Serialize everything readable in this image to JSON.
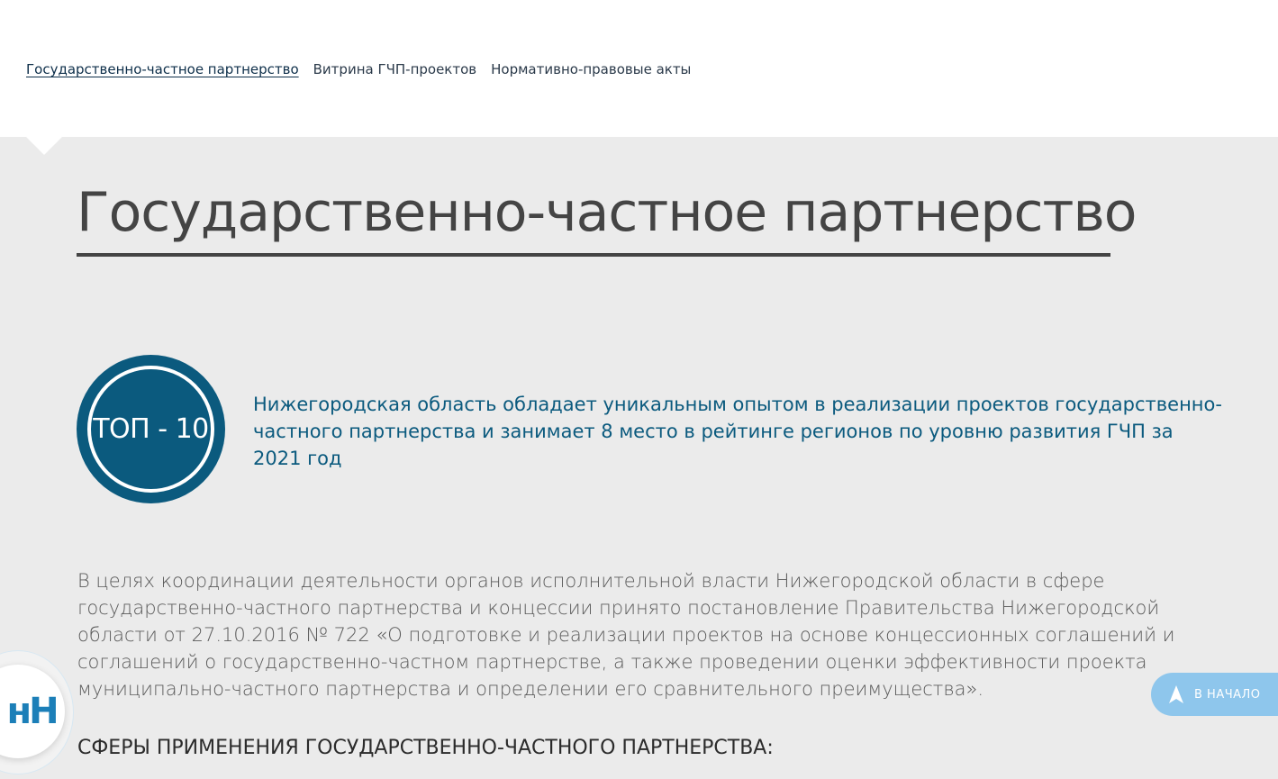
{
  "nav": {
    "items": [
      {
        "label": "Государственно-частное партнерство",
        "active": true
      },
      {
        "label": "Витрина ГЧП-проектов",
        "active": false
      },
      {
        "label": "Нормативно-правовые акты",
        "active": false
      }
    ]
  },
  "main": {
    "title": "Государственно-частное партнерство",
    "badge_text": "ТОП - 10",
    "highlight": "Нижегородская область обладает уникальным опытом в реализации проектов государственно-частного партнерства и занимает 8 место в рейтинге регионов по уровню развития ГЧП за 2021 год",
    "body": "В целях координации деятельности органов исполнительной власти Нижегородской области в сфере государственно-частного партнерства и концессии принято постановление Правительства Нижегородской области от 27.10.2016 № 722 «О подготовке и реализации проектов на основе концессионных соглашений и соглашений о государственно-частном партнерстве, а также проведении оценки эффективности проекта муниципально-частного партнерства и определении его сравнительного преимущества».",
    "section_heading": "СФЕРЫ ПРИМЕНЕНИЯ ГОСУДАРСТВЕННО-ЧАСТНОГО ПАРТНЕРСТВА:"
  },
  "widgets": {
    "logo_letters": "нН",
    "scroll_top_label": "В НАЧАЛО",
    "scroll_top_icon": "arrow-up-icon"
  },
  "colors": {
    "accent": "#0b5a7e",
    "content_bg": "#ebebeb",
    "scroll_button": "#8ec6ec",
    "logo": "#1c7fb8"
  }
}
